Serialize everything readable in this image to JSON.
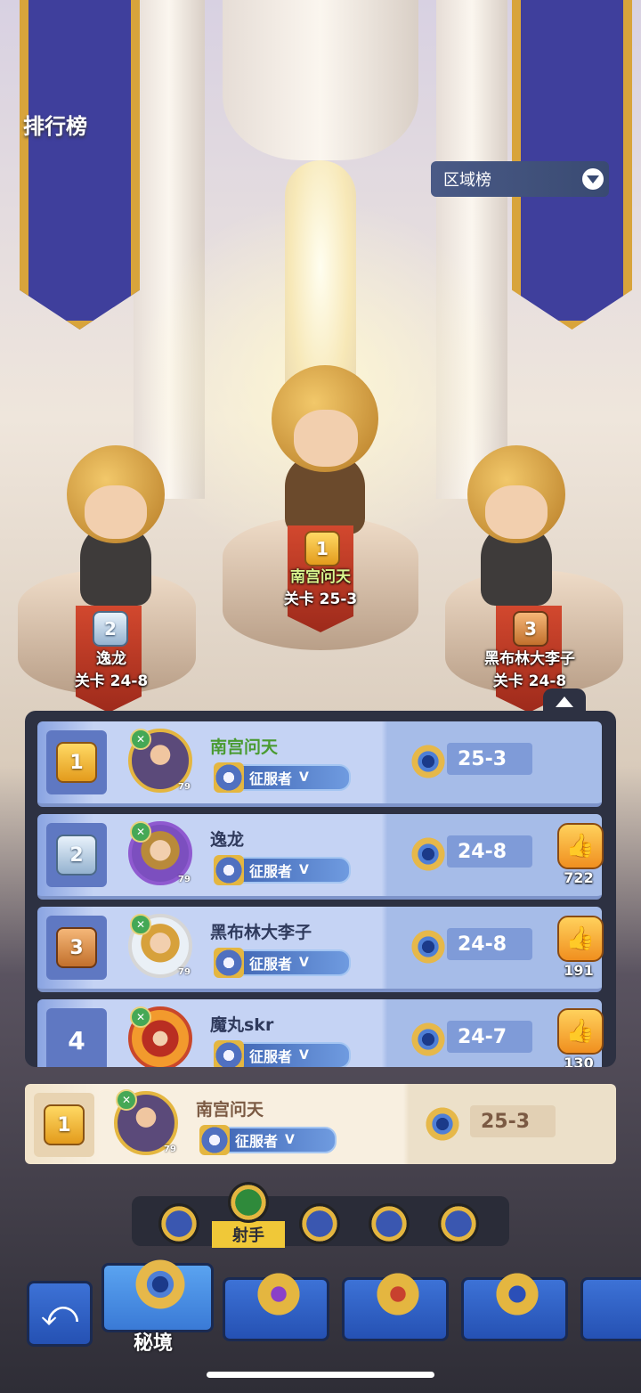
{
  "header": {
    "title": "排行榜",
    "region_select": "区域榜"
  },
  "podium": [
    {
      "rank": "2",
      "name": "逸龙",
      "stage": "关卡 24-8"
    },
    {
      "rank": "1",
      "name": "南宫问天",
      "stage": "关卡 25-3"
    },
    {
      "rank": "3",
      "name": "黑布林大李子",
      "stage": "关卡 24-8"
    }
  ],
  "list": [
    {
      "rank": "1",
      "name": "南宫问天",
      "level": "79",
      "title": "征服者",
      "title_tier": "V",
      "stage": "25-3",
      "likes": ""
    },
    {
      "rank": "2",
      "name": "逸龙",
      "level": "79",
      "title": "征服者",
      "title_tier": "V",
      "stage": "24-8",
      "likes": "722"
    },
    {
      "rank": "3",
      "name": "黑布林大李子",
      "level": "79",
      "title": "征服者",
      "title_tier": "V",
      "stage": "24-8",
      "likes": "191"
    },
    {
      "rank": "4",
      "name": "魔丸skr",
      "level": "79",
      "title": "征服者",
      "title_tier": "V",
      "stage": "24-7",
      "likes": "130"
    }
  ],
  "mine": {
    "rank": "1",
    "name": "南宫问天",
    "level": "79",
    "title": "征服者",
    "title_tier": "V",
    "stage": "25-3"
  },
  "class_tabs": {
    "active_label": "射手"
  },
  "bottom_nav": {
    "active_label": "秘境"
  },
  "colors": {
    "accent": "#f0c838",
    "row_bg": "#c5d3f4",
    "panel_bg": "#2d3142"
  }
}
